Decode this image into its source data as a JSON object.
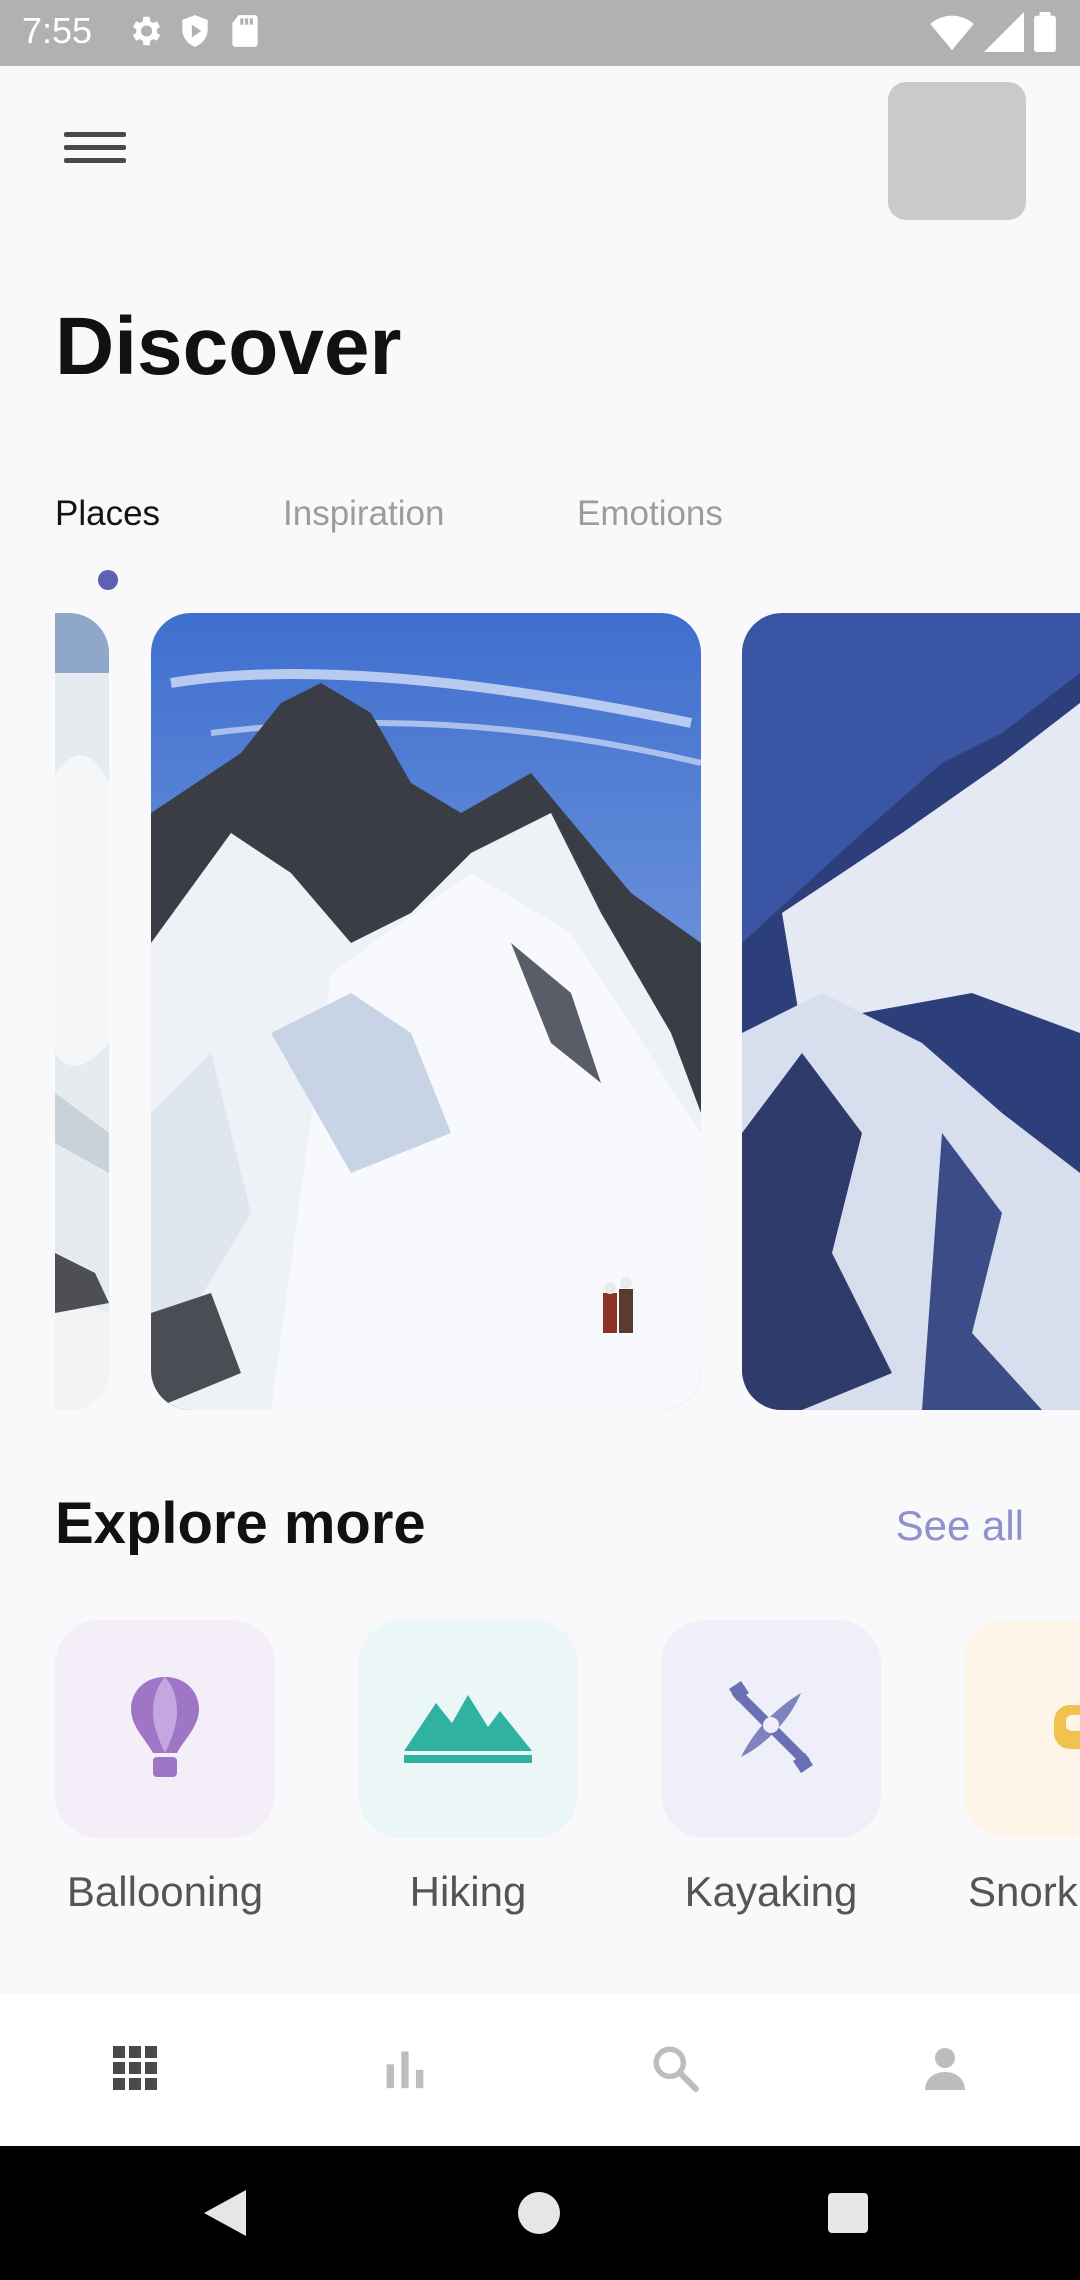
{
  "status_bar": {
    "time": "7:55",
    "icons": [
      "gear-icon",
      "shield-icon",
      "sd-card-icon",
      "wifi-icon",
      "signal-icon",
      "battery-icon"
    ]
  },
  "header": {
    "menu_icon": "hamburger-menu-icon",
    "title": "Discover"
  },
  "tabs": [
    {
      "label": "Places",
      "active": true
    },
    {
      "label": "Inspiration",
      "active": false
    },
    {
      "label": "Emotions",
      "active": false
    }
  ],
  "carousel": {
    "cards": [
      "mountain-photo-partial-left",
      "snowy-ridge-climbers-photo",
      "mountain-photo-partial-right"
    ]
  },
  "explore": {
    "title": "Explore more",
    "see_all": "See all",
    "categories": [
      {
        "label": "Ballooning",
        "icon": "hot-air-balloon-icon",
        "tile_color": "#f3eef7",
        "icon_color": "#9f76c6"
      },
      {
        "label": "Hiking",
        "icon": "mountains-icon",
        "tile_color": "#eaf7f6",
        "icon_color": "#2fb3a0"
      },
      {
        "label": "Kayaking",
        "icon": "kayak-icon",
        "tile_color": "#eeeff8",
        "icon_color": "#6b6fb6"
      },
      {
        "label": "Snork",
        "icon": "snorkel-mask-icon",
        "tile_color": "#fdf6e8",
        "icon_color": "#f2c24e"
      }
    ]
  },
  "bottom_nav": [
    {
      "icon": "grid-icon",
      "active": true
    },
    {
      "icon": "bar-chart-icon",
      "active": false
    },
    {
      "icon": "search-icon",
      "active": false
    },
    {
      "icon": "person-icon",
      "active": false
    }
  ],
  "colors": {
    "accent": "#5c61b3",
    "see_all": "#8f92c9",
    "title": "#111111"
  }
}
